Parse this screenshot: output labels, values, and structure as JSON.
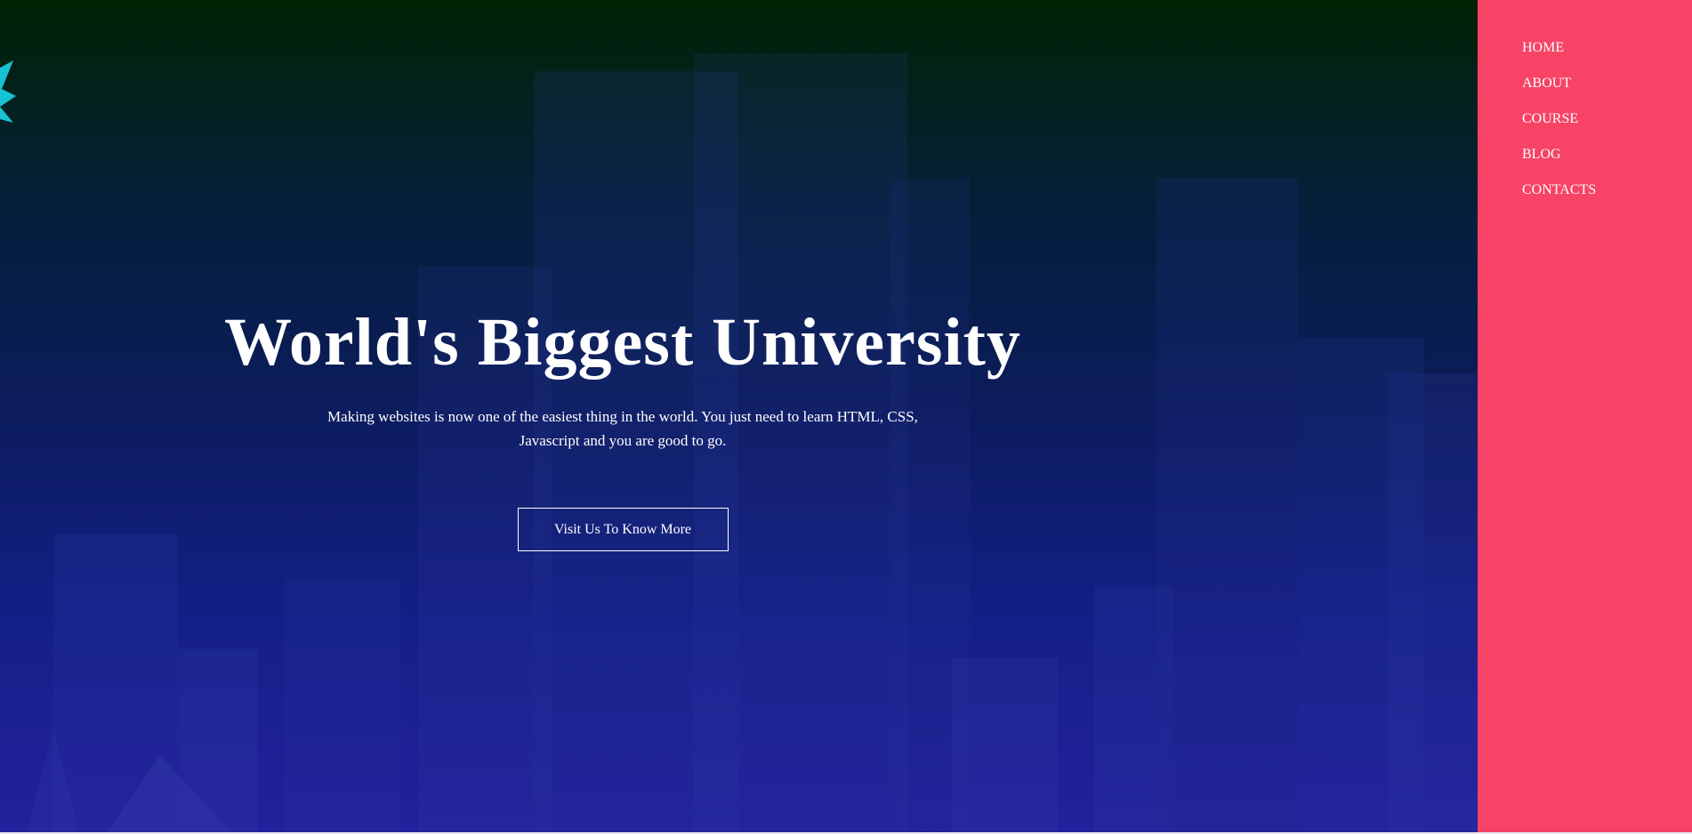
{
  "hero": {
    "title": "World's Biggest University",
    "text": "Making websites is now one of the easiest thing in the world. You just need to learn HTML, CSS, Javascript and you are good to go.",
    "button_label": "Visit Us To Know More"
  },
  "nav": {
    "items": [
      "HOME",
      "ABOUT",
      "COURSE",
      "BLOG",
      "CONTACTS"
    ]
  },
  "colors": {
    "sidebar": "#f64366",
    "hero_top": "#022204",
    "hero_bottom": "#23219c",
    "logo_accent": "#17c3d3"
  },
  "icons": {
    "logo": "cyan-leaf-logo-icon"
  }
}
